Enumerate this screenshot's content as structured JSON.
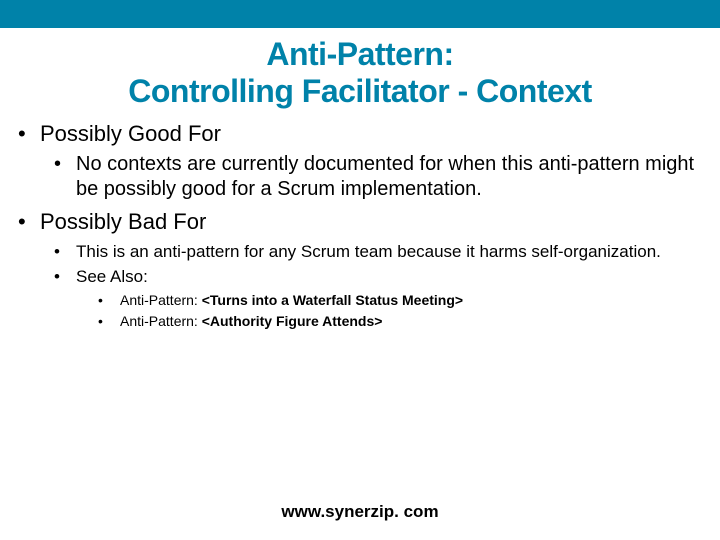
{
  "title_line1": "Anti-Pattern:",
  "title_line2": "Controlling Facilitator - Context",
  "sections": {
    "good": {
      "heading": "Possibly Good For",
      "items": [
        {
          "text": "No contexts are currently documented for when this anti-pattern might be possibly good for a Scrum implementation."
        }
      ]
    },
    "bad": {
      "heading": "Possibly Bad For",
      "items": [
        {
          "text": "This is an anti-pattern for any Scrum team because it harms self-organization."
        },
        {
          "text": "See Also:",
          "sub": [
            {
              "prefix": "Anti-Pattern: ",
              "bold": "<Turns into a Waterfall Status Meeting>"
            },
            {
              "prefix": "Anti-Pattern: ",
              "bold": "<Authority Figure Attends>"
            }
          ]
        }
      ]
    }
  },
  "footer": "www.synerzip. com"
}
